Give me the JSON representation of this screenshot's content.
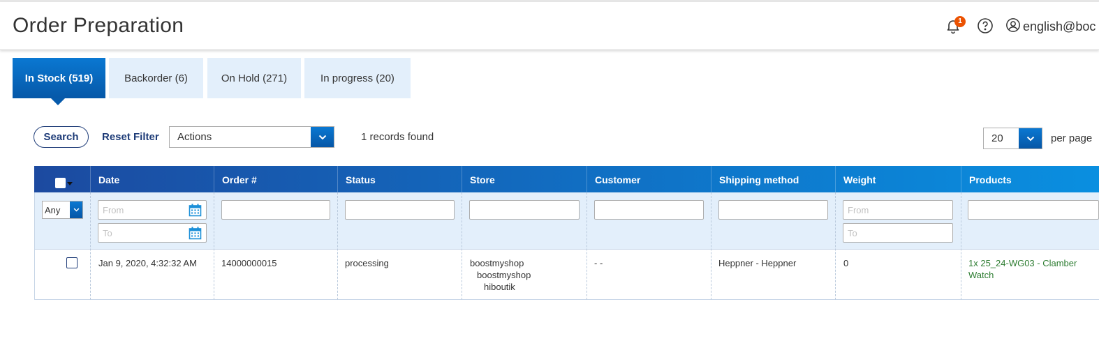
{
  "header": {
    "title": "Order Preparation",
    "notification_count": "1",
    "user": "english@boc"
  },
  "tabs": [
    {
      "label": "In Stock (519)",
      "active": true
    },
    {
      "label": "Backorder (6)",
      "active": false
    },
    {
      "label": "On Hold (271)",
      "active": false
    },
    {
      "label": "In progress (20)",
      "active": false
    }
  ],
  "toolbar": {
    "search_label": "Search",
    "reset_label": "Reset Filter",
    "actions_value": "Actions",
    "records_found": "1 records found",
    "per_page_value": "20",
    "per_page_label": "per page"
  },
  "grid": {
    "columns": [
      "Date",
      "Order #",
      "Status",
      "Store",
      "Customer",
      "Shipping method",
      "Weight",
      "Products"
    ],
    "filters": {
      "select_any": "Any",
      "date_from": "From",
      "date_to": "To",
      "weight_from": "From",
      "weight_to": "To"
    },
    "rows": [
      {
        "date": "Jan 9, 2020, 4:32:32 AM",
        "order": "14000000015",
        "status": "processing",
        "store": [
          "boostmyshop",
          "boostmyshop",
          "hiboutik"
        ],
        "customer": "- -",
        "shipping": "Heppner - Heppner",
        "weight": "0",
        "products": [
          "1x 25_24-WG03 - Clamber",
          "Watch"
        ]
      }
    ]
  },
  "colors": {
    "accent": "#0a78d2",
    "nav_dark": "#1e3c78",
    "tab_inactive": "#e3effb",
    "badge": "#eb5202",
    "product_link": "#2e7d32"
  }
}
